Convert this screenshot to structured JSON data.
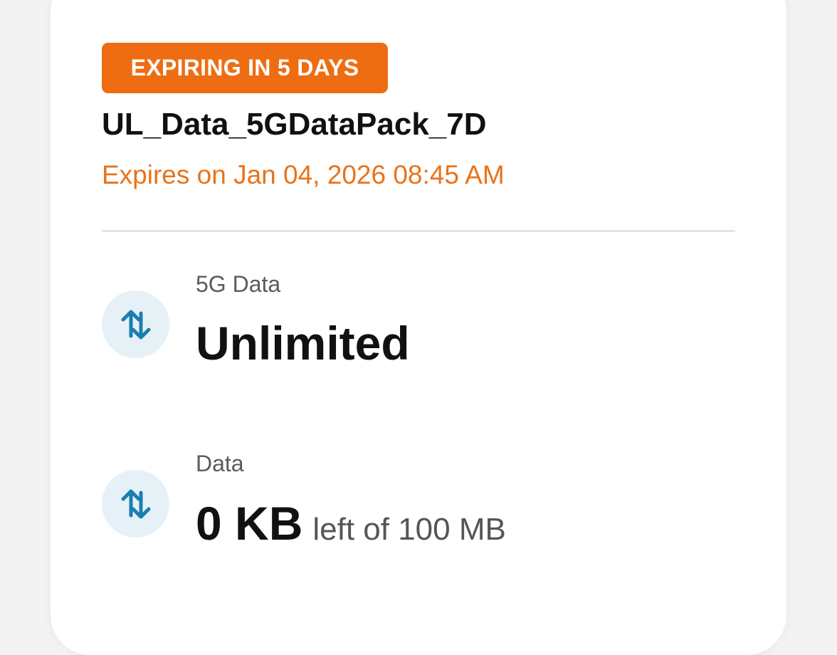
{
  "plan": {
    "badge": "EXPIRING IN 5 DAYS",
    "name": "UL_Data_5GDataPack_7D",
    "expires": "Expires on Jan 04, 2026 08:45 AM"
  },
  "balances": [
    {
      "label": "5G Data",
      "value": "Unlimited",
      "icon": "data-transfer-icon"
    },
    {
      "label": "Data",
      "value": "0 KB",
      "sub": "left of 100 MB",
      "icon": "data-transfer-icon"
    }
  ],
  "colors": {
    "accent": "#ee6d12",
    "expires_text": "#e8731a",
    "icon": "#1a7fb0",
    "icon_bg": "#e6f1f7"
  }
}
